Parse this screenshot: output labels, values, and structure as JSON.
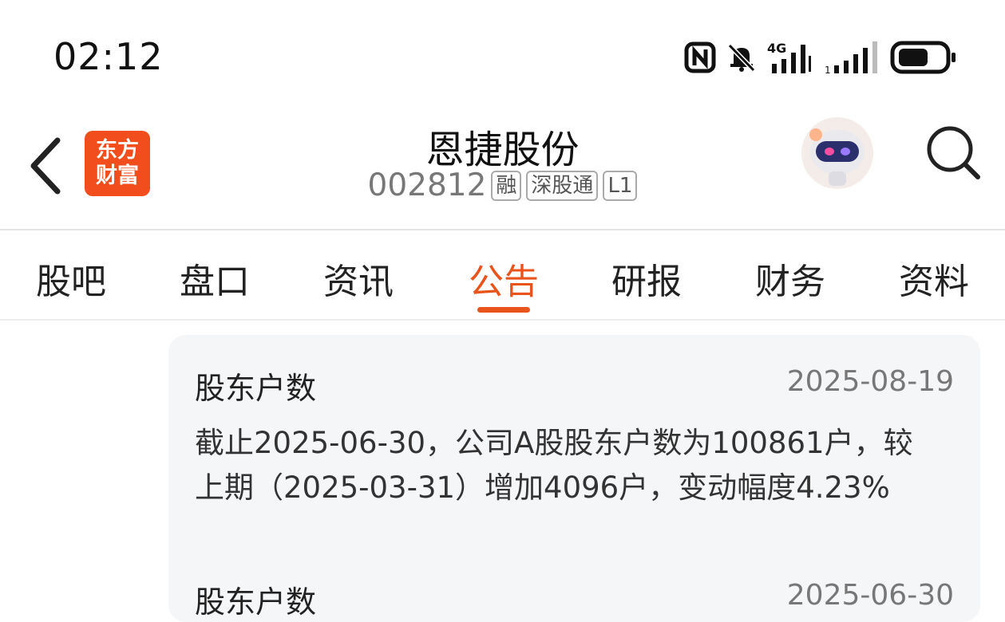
{
  "status_bar": {
    "time": "02:12",
    "icons": [
      "nfc-icon",
      "bell-muted-icon",
      "4g-signal-icon",
      "signal-icon",
      "battery-icon"
    ],
    "network_label": "4G"
  },
  "header": {
    "logo_line1": "东方",
    "logo_line2": "财富",
    "stock_name": "恩捷股份",
    "stock_code": "002812",
    "tags": [
      "融",
      "深股通",
      "L1"
    ]
  },
  "tabs": [
    {
      "label": "股吧",
      "active": false
    },
    {
      "label": "盘口",
      "active": false
    },
    {
      "label": "资讯",
      "active": false
    },
    {
      "label": "公告",
      "active": true
    },
    {
      "label": "研报",
      "active": false
    },
    {
      "label": "财务",
      "active": false
    },
    {
      "label": "资料",
      "active": false
    }
  ],
  "announcements": [
    {
      "title": "股东户数",
      "date": "2025-08-19",
      "body": "截止2025-06-30，公司A股股东户数为100861户，较上期（2025-03-31）增加4096户，变动幅度4.23%"
    },
    {
      "title": "股东户数",
      "date": "2025-06-30",
      "body": ""
    }
  ],
  "colors": {
    "accent": "#e8541c",
    "logo_bg": "#f24d1c",
    "card_bg": "#f5f6f8"
  }
}
